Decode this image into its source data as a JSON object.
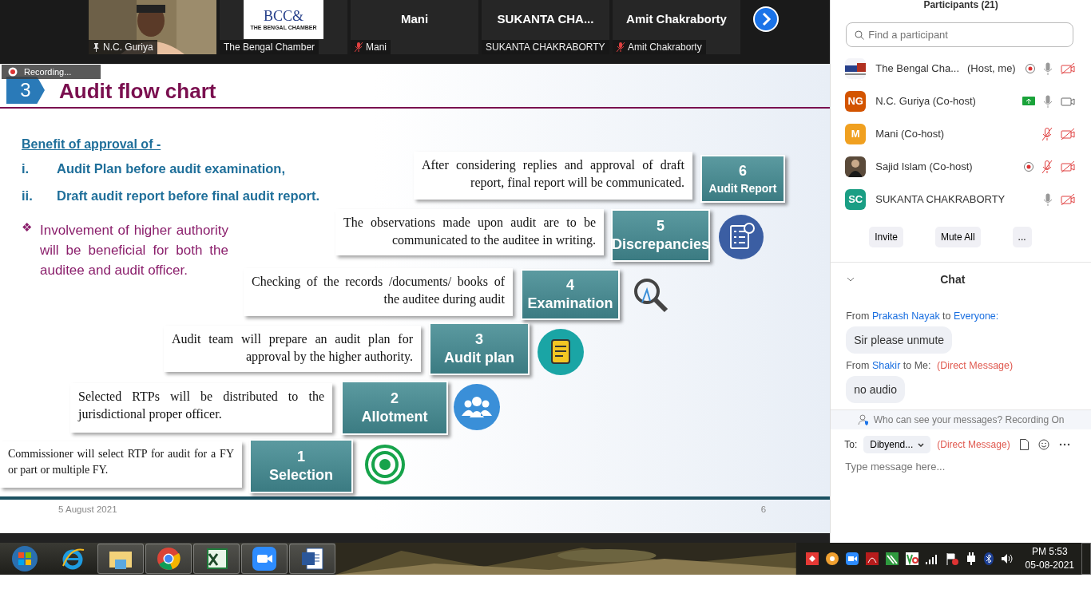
{
  "video_strip": {
    "tiles": [
      {
        "kind": "video",
        "label": "N.C. Guriya",
        "pinned": true,
        "muted": false
      },
      {
        "kind": "logo",
        "logo_mark": "BCC&",
        "logo_sub": "THE BENGAL CHAMBER",
        "label": "The Bengal Chamber",
        "muted": false
      },
      {
        "kind": "name",
        "name": "Mani",
        "label": "Mani",
        "muted": true
      },
      {
        "kind": "name",
        "name": "SUKANTA CHA...",
        "label": "SUKANTA CHAKRABORTY",
        "muted": false
      },
      {
        "kind": "name",
        "name": "Amit Chakraborty",
        "label": "Amit Chakraborty",
        "muted": true
      }
    ]
  },
  "recording_badge": "Recording...",
  "slide": {
    "number": "3",
    "title": "Audit flow chart",
    "benefit_heading": "Benefit of approval of  -",
    "benefits": [
      {
        "marker": "i.",
        "text": "Audit Plan before audit examination,"
      },
      {
        "marker": "ii.",
        "text": "Draft audit report before final audit report."
      }
    ],
    "bullet_mark": "❖",
    "bullet": "Involvement of higher authority will be beneficial for both the auditee and audit officer.",
    "steps": [
      {
        "kind": "target",
        "number": "1",
        "label": "Selection",
        "description": "Commissioner will select RTP for audit for a FY or part or multiple FY."
      },
      {
        "kind": "people",
        "number": "2",
        "label": "Allotment",
        "description": "Selected RTPs will be distributed to the jurisdictional proper officer."
      },
      {
        "kind": "document",
        "number": "3",
        "label": "Audit plan",
        "description": "Audit team will prepare an audit plan for approval by the higher authority."
      },
      {
        "kind": "magnifier",
        "number": "4",
        "label": "Examination",
        "description": "Checking of the records /documents/ books of the auditee during audit"
      },
      {
        "kind": "checklist",
        "number": "5",
        "label": "Discrepancies",
        "description": "The observations made upon audit are to be communicated to the auditee in writing."
      },
      {
        "kind": "plain",
        "number": "6",
        "label": "Audit Report",
        "description": "After considering replies and approval of draft report, final report will be communicated."
      }
    ],
    "date": "5 August 2021",
    "page": "6"
  },
  "participants": {
    "title": "Participants (21)",
    "search_placeholder": "Find a participant",
    "items": [
      {
        "kind": "logo",
        "name": "The Bengal Cha...",
        "role": "(Host, me)",
        "recording": true,
        "sharing": false,
        "muted": false,
        "video_on": false
      },
      {
        "kind": "initials",
        "initials": "NG",
        "color": "#d35400",
        "name": "N.C. Guriya (Co-host)",
        "recording": false,
        "sharing": true,
        "muted": false,
        "video_on": true
      },
      {
        "kind": "initials",
        "initials": "M",
        "color": "#f0a020",
        "name": "Mani (Co-host)",
        "recording": false,
        "sharing": false,
        "muted": true,
        "video_on": false
      },
      {
        "name": "Sajid Islam (Co-host)",
        "recording": true,
        "sharing": false,
        "muted": true,
        "video_on": false
      },
      {
        "kind": "initials",
        "initials": "SC",
        "color": "#1a9e84",
        "name": "SUKANTA CHAKRABORTY",
        "recording": false,
        "sharing": false,
        "muted": false,
        "video_on": false
      }
    ],
    "buttons": [
      "Invite",
      "Mute All",
      "..."
    ]
  },
  "chat": {
    "title": "Chat",
    "messages": [
      {
        "from_word": "From",
        "from": "Prakash Nayak",
        "to_word": "to",
        "to": "Everyone:",
        "to_self": false,
        "direct": false,
        "text": "Sir please unmute"
      },
      {
        "from_word": "From",
        "from": "Shakir",
        "to_word": "to",
        "to": "Me:",
        "to_self": true,
        "direct": true,
        "direct_label": "(Direct Message)",
        "text": "no audio"
      }
    ],
    "notice": "Who can see your messages? Recording On",
    "to_label": "To:",
    "recipient": "Dibyend...",
    "recipient_note": "(Direct Message)",
    "placeholder": "Type message here..."
  },
  "taskbar": {
    "apps": [
      {
        "kind": "start",
        "running": false
      },
      {
        "kind": "browser",
        "running": false
      },
      {
        "kind": "folder",
        "running": true
      },
      {
        "kind": "chrome",
        "running": true
      },
      {
        "kind": "sheet",
        "running": true
      },
      {
        "kind": "camera",
        "running": true
      },
      {
        "kind": "doc",
        "running": true
      }
    ],
    "tray": [
      {
        "kind": "red"
      },
      {
        "kind": "orange"
      },
      {
        "kind": "camera"
      },
      {
        "kind": "pdf"
      },
      {
        "kind": "green"
      },
      {
        "kind": "ve"
      },
      {
        "kind": "signal"
      },
      {
        "kind": "flag"
      },
      {
        "kind": "plug"
      },
      {
        "kind": "bluetooth"
      },
      {
        "kind": "speaker"
      }
    ],
    "time": "PM 5:53",
    "date": "05-08-2021"
  }
}
